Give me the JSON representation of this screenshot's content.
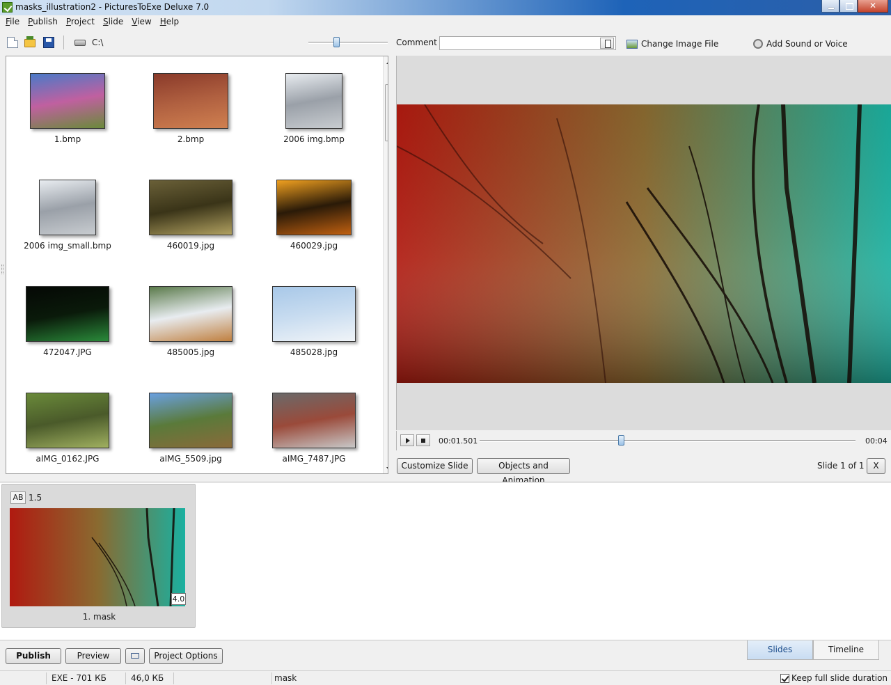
{
  "window": {
    "title": "masks_illustration2 - PicturesToExe Deluxe 7.0"
  },
  "menu": [
    {
      "label": "File",
      "key": "F",
      "rest": "ile"
    },
    {
      "label": "Publish",
      "key": "P",
      "rest": "ublish"
    },
    {
      "label": "Project",
      "key": "P",
      "rest": "roject"
    },
    {
      "label": "Slide",
      "key": "S",
      "rest": "lide"
    },
    {
      "label": "View",
      "key": "V",
      "rest": "iew"
    },
    {
      "label": "Help",
      "key": "H",
      "rest": "elp"
    }
  ],
  "toolbar": {
    "path": "C:\\",
    "zoom_fraction": 0.35,
    "icons": [
      "new-icon",
      "open-icon",
      "save-icon",
      "drive-icon"
    ]
  },
  "files": [
    {
      "name": "1.bmp",
      "colors": [
        "#4a7ac8",
        "#6a8a3a",
        "#c060a0"
      ]
    },
    {
      "name": "2.bmp",
      "colors": [
        "#8a3a2a",
        "#d08050",
        "#b06040"
      ]
    },
    {
      "name": "2006 img.bmp",
      "colors": [
        "#e8ecf0",
        "#c8ccd0",
        "#9aa0a8"
      ]
    },
    {
      "name": "2006 img_small.bmp",
      "colors": [
        "#e8ecf0",
        "#c8ccd0",
        "#9aa0a8"
      ]
    },
    {
      "name": "460019.jpg",
      "colors": [
        "#6a6038",
        "#b0a060",
        "#3a3418"
      ]
    },
    {
      "name": "460029.jpg",
      "colors": [
        "#f0a020",
        "#c06010",
        "#2a1a08"
      ]
    },
    {
      "name": "472047.JPG",
      "colors": [
        "#050805",
        "#2a8a3a",
        "#0a1a0a"
      ]
    },
    {
      "name": "485005.jpg",
      "colors": [
        "#5a7a4a",
        "#c08040",
        "#e8ecf0"
      ]
    },
    {
      "name": "485028.jpg",
      "colors": [
        "#a8c8e8",
        "#f0f4f8",
        "#c8dcf0"
      ]
    },
    {
      "name": "aIMG_0162.JPG",
      "colors": [
        "#6a8a3a",
        "#a0b060",
        "#4a5a2a"
      ]
    },
    {
      "name": "aIMG_5509.jpg",
      "colors": [
        "#6aa0e0",
        "#8a6a3a",
        "#5a7a3a"
      ]
    },
    {
      "name": "aIMG_7487.JPG",
      "colors": [
        "#6a6a6a",
        "#c8c8c8",
        "#9a4a3a"
      ]
    }
  ],
  "comment": {
    "label": "Comment",
    "value": "",
    "placeholder": ""
  },
  "actions": {
    "change_image": "Change Image File",
    "add_sound": "Add Sound or Voice"
  },
  "preview": {
    "colors": {
      "left": "#b01a10",
      "middle": "#8a6a30",
      "right": "#1ab0a0"
    },
    "time_current": "00:01.501",
    "time_total": "00:04",
    "progress_fraction": 0.375
  },
  "buttons": {
    "customize_slide": "Customize Slide",
    "objects_animation": "Objects and Animation",
    "slide_counter": "Slide 1 of 1",
    "close_x": "X",
    "publish": "Publish",
    "preview": "Preview",
    "project_options": "Project Options"
  },
  "slide": {
    "transition_badge": "AB",
    "transition_duration": "1.5",
    "duration": "4.0",
    "name": "1. mask"
  },
  "tabs": {
    "slides": "Slides",
    "timeline": "Timeline"
  },
  "status": {
    "exe_size": "EXE - 701 КБ",
    "file_size": "46,0 КБ",
    "slide_name": "mask",
    "keep_duration": "Keep full slide duration"
  }
}
